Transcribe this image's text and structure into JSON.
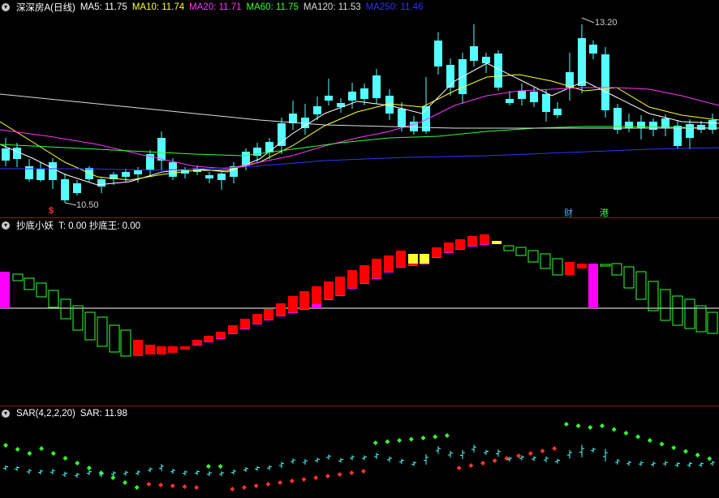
{
  "main": {
    "title": "深深房A(日线)",
    "ma": [
      {
        "label": "MA5: 11.75",
        "color": "#ffffff"
      },
      {
        "label": "MA10: 11.74",
        "color": "#ffff33"
      },
      {
        "label": "MA20: 11.71",
        "color": "#ff33ff"
      },
      {
        "label": "MA60: 11.75",
        "color": "#33ff33"
      },
      {
        "label": "MA120: 11.53",
        "color": "#dddddd"
      },
      {
        "label": "MA250: 11.46",
        "color": "#3333ff"
      }
    ],
    "high_label": "13.20",
    "low_label": "10.50",
    "marks": {
      "s": "$",
      "cai": "财",
      "gang": "港"
    }
  },
  "ind1": {
    "title": "抄底小妖",
    "values": "T: 0.00  抄底王: 0.00"
  },
  "ind2": {
    "title": "SAR(4,2,2,20)",
    "values": "SAR: 11.98"
  },
  "colors": {
    "up": "#ff3333",
    "down": "#54ffff",
    "bg": "#000000",
    "border": "#8b1a1a"
  }
}
